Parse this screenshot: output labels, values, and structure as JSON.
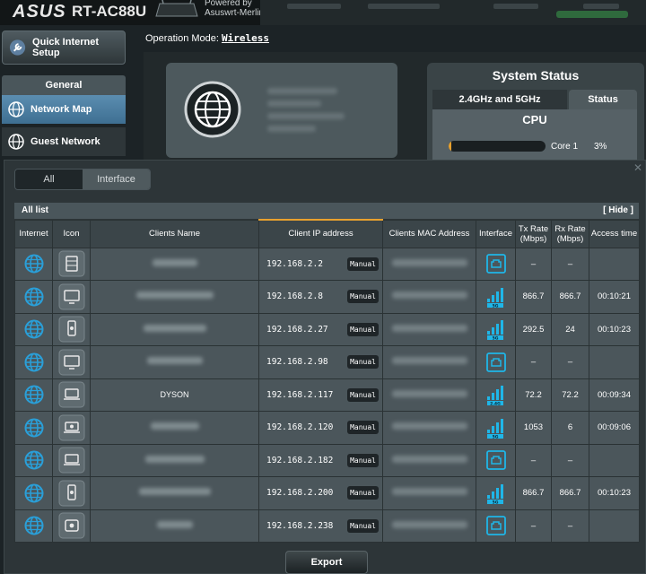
{
  "brand": {
    "logo": "ASUS",
    "model": "RT-AC88U",
    "powered_line1": "Powered by",
    "powered_line2": "Asuswrt-Merlin"
  },
  "sidebar": {
    "qis_label": "Quick Internet Setup",
    "section": "General",
    "items": [
      {
        "label": "Network Map",
        "active": true
      },
      {
        "label": "Guest Network",
        "active": false
      }
    ]
  },
  "operation_mode": {
    "label": "Operation Mode:",
    "value": "Wireless"
  },
  "system_status": {
    "title": "System Status",
    "tabs": [
      "2.4GHz and 5GHz",
      "Status"
    ],
    "cpu_title": "CPU",
    "core_label": "Core 1",
    "core_value": "3%",
    "core_fraction": 0.03
  },
  "client_list": {
    "filters": [
      "All",
      "Interface"
    ],
    "active_filter": "Interface",
    "list_title": "All list",
    "hide_label": "[ Hide ]",
    "columns": [
      "Internet",
      "Icon",
      "Clients Name",
      "Client IP address",
      "Clients MAC Address",
      "Interface",
      "Tx Rate (Mbps)",
      "Rx Rate (Mbps)",
      "Access time"
    ],
    "manual_label": "Manual",
    "rows": [
      {
        "device": "server",
        "name": "",
        "ip": "192.168.2.2",
        "iface": "wired",
        "tx": "–",
        "rx": "–",
        "time": ""
      },
      {
        "device": "monitor",
        "name": "",
        "ip": "192.168.2.8",
        "iface": "5G",
        "tx": "866.7",
        "rx": "866.7",
        "time": "00:10:21"
      },
      {
        "device": "phone",
        "name": "",
        "ip": "192.168.2.27",
        "iface": "5G",
        "tx": "292.5",
        "rx": "24",
        "time": "00:10:23"
      },
      {
        "device": "monitor",
        "name": "",
        "ip": "192.168.2.98",
        "iface": "wired",
        "tx": "–",
        "rx": "–",
        "time": ""
      },
      {
        "device": "laptop",
        "name": "DYSON",
        "ip": "192.168.2.117",
        "iface": "2.4G",
        "tx": "72.2",
        "rx": "72.2",
        "time": "00:09:34"
      },
      {
        "device": "apple-laptop",
        "name": "",
        "ip": "192.168.2.120",
        "iface": "5G",
        "tx": "1053",
        "rx": "6",
        "time": "00:09:06"
      },
      {
        "device": "laptop",
        "name": "",
        "ip": "192.168.2.182",
        "iface": "wired",
        "tx": "–",
        "rx": "–",
        "time": ""
      },
      {
        "device": "phone",
        "name": "",
        "ip": "192.168.2.200",
        "iface": "5G",
        "tx": "866.7",
        "rx": "866.7",
        "time": "00:10:23"
      },
      {
        "device": "apple-tv",
        "name": "",
        "ip": "192.168.2.238",
        "iface": "wired",
        "tx": "–",
        "rx": "–",
        "time": ""
      }
    ],
    "export_label": "Export"
  },
  "colors": {
    "accent": "#e8a12e",
    "wifi": "#1fb6e8",
    "globe": "#2a9fd8"
  }
}
